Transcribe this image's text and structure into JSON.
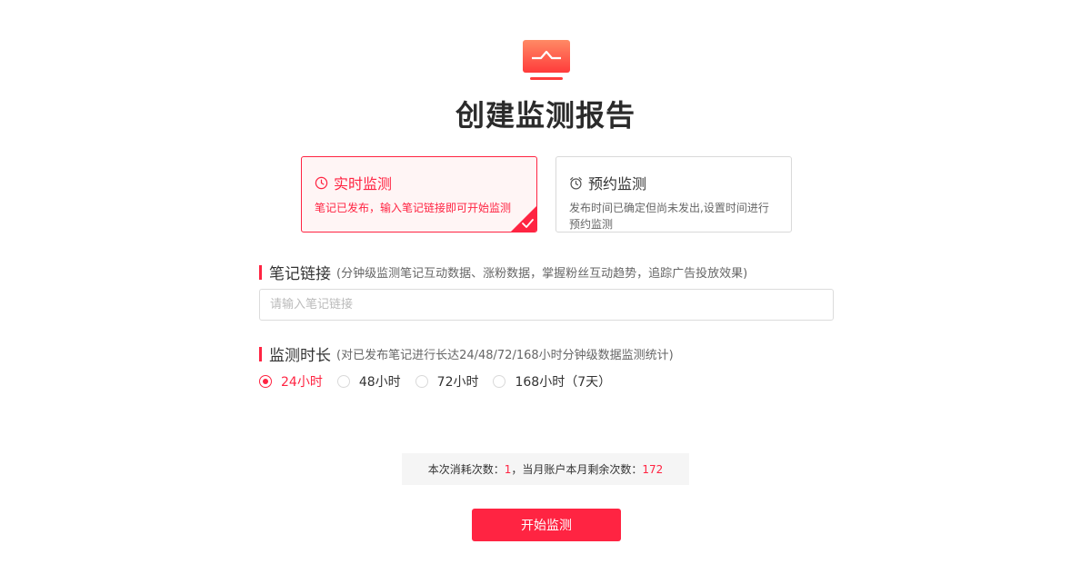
{
  "title": "创建监测报告",
  "modes": [
    {
      "title": "实时监测",
      "desc": "笔记已发布，输入笔记链接即可开始监测",
      "selected": true,
      "icon": "clock-icon"
    },
    {
      "title": "预约监测",
      "desc": "发布时间已确定但尚未发出,设置时间进行预约监测",
      "selected": false,
      "icon": "alarm-clock-icon"
    }
  ],
  "note_link": {
    "title": "笔记链接",
    "hint": "(分钟级监测笔记互动数据、涨粉数据，掌握粉丝互动趋势，追踪广告投放效果)",
    "placeholder": "请输入笔记链接",
    "value": ""
  },
  "duration": {
    "title": "监测时长",
    "hint": "(对已发布笔记进行长达24/48/72/168小时分钟级数据监测统计)",
    "options": [
      "24小时",
      "48小时",
      "72小时",
      "168小时（7天）"
    ],
    "selected": "24小时"
  },
  "quota": {
    "consume_label": "本次消耗次数：",
    "consume_value": "1",
    "separator": "，",
    "remain_label": "当月账户本月剩余次数：",
    "remain_value": "172"
  },
  "start_button": "开始监测",
  "colors": {
    "accent": "#ff2442",
    "card_selected_bg": "#fff5f5"
  }
}
